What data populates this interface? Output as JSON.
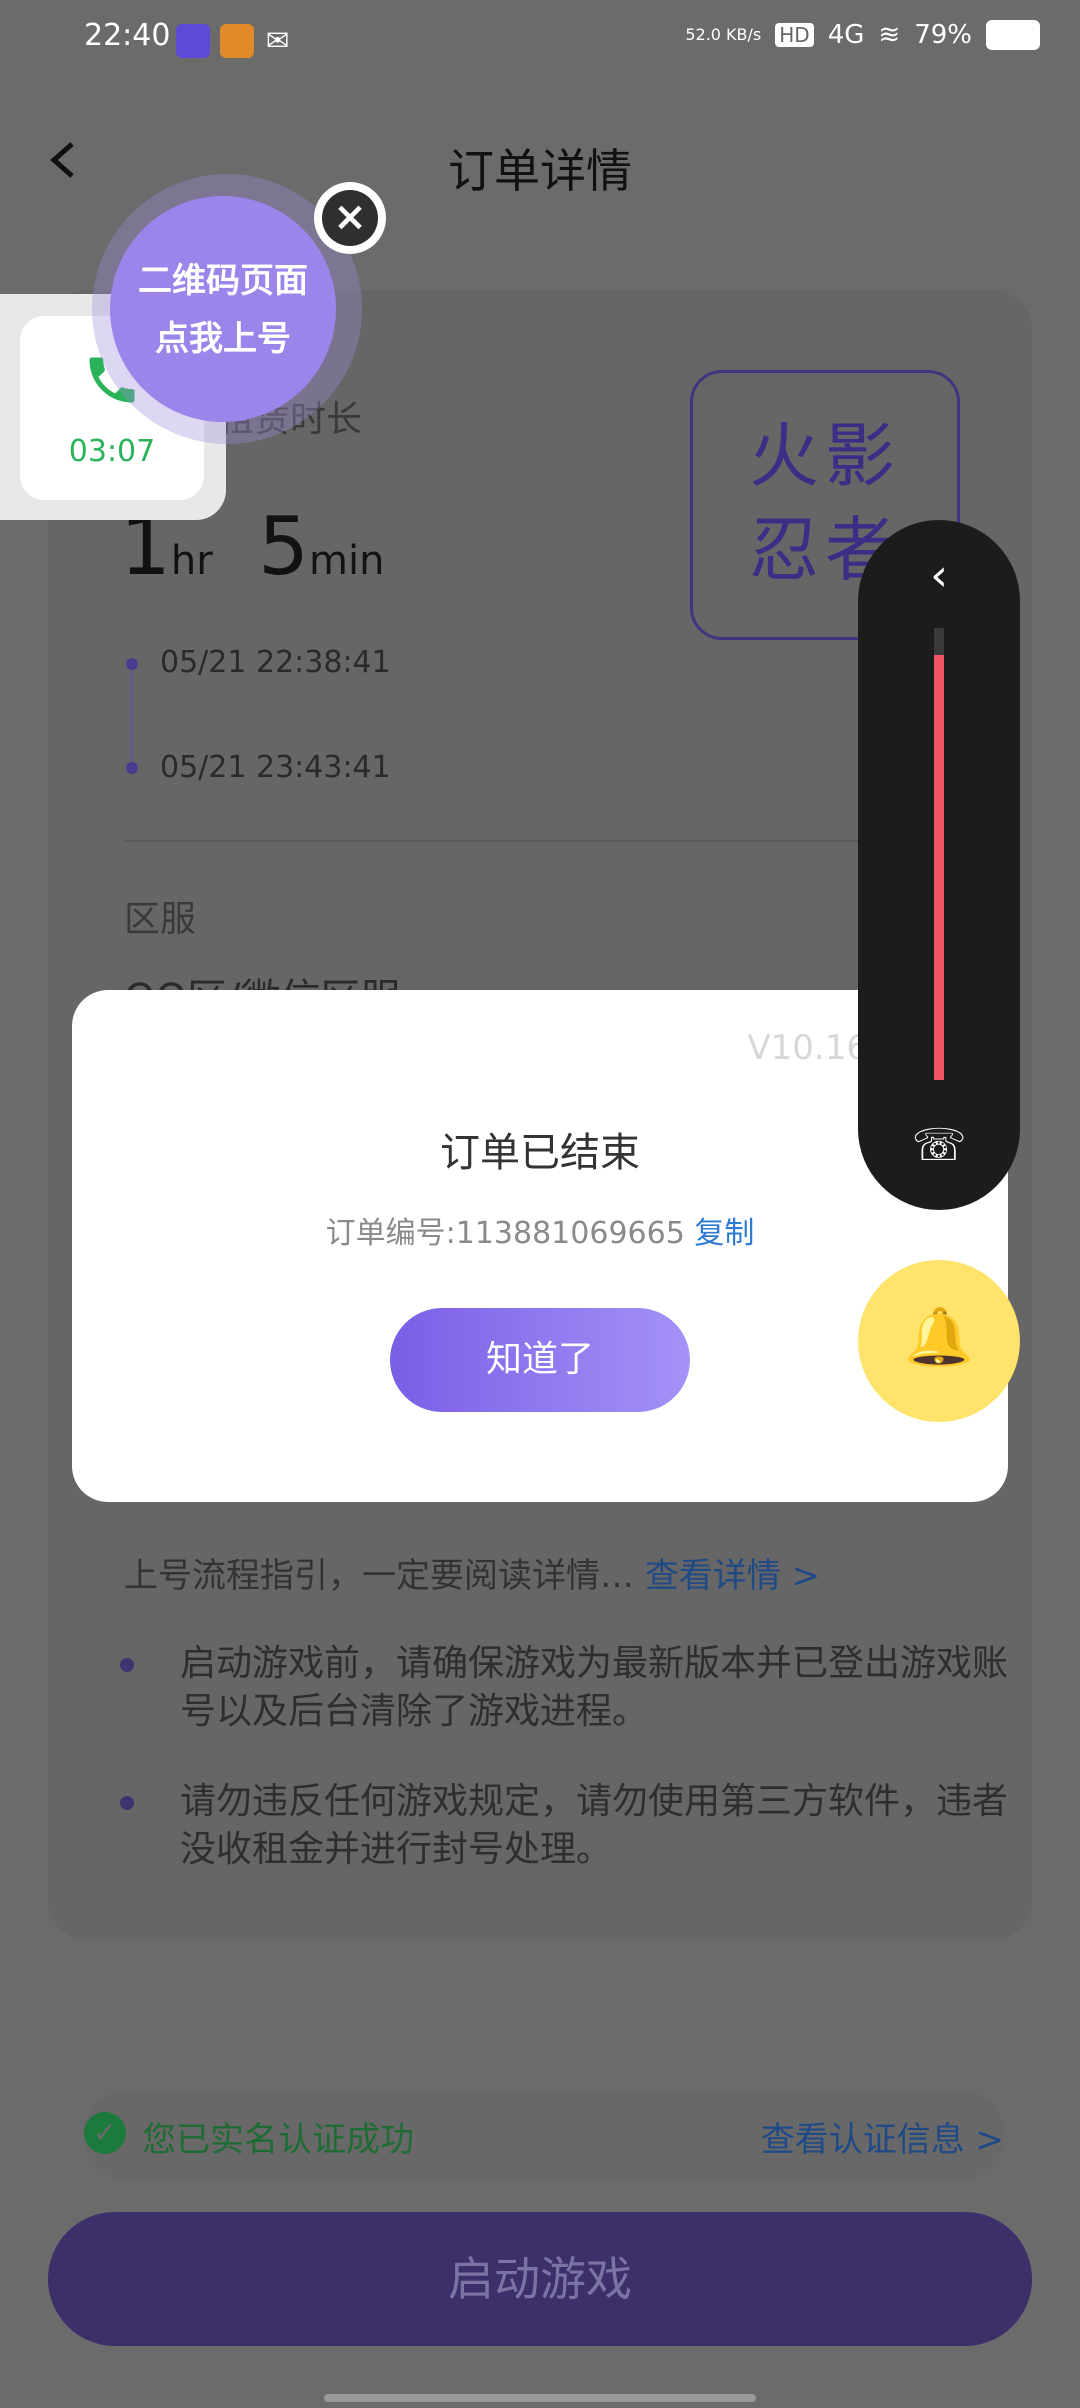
{
  "status": {
    "time": "22:40",
    "net": "52.0 KB/s",
    "hd": "HD",
    "signal": "4G",
    "battery": "79%"
  },
  "header": {
    "title": "订单详情"
  },
  "order": {
    "duration_label": "租赁时长",
    "duration_h": "1",
    "duration_h_unit": "hr",
    "duration_m": "5",
    "duration_m_unit": "min",
    "start": "05/21 22:38:41",
    "end": "05/21 23:43:41",
    "server_label": "区服",
    "server_value": "QQ区/微信区服",
    "game_stamp_line1": "火影",
    "game_stamp_line2": "忍者"
  },
  "guide": {
    "text": "上号流程指引，一定要阅读详情…",
    "link": "查看详情 >",
    "bullets": [
      "启动游戏前，请确保游戏为最新版本并已登出游戏账号以及后台清除了游戏进程。",
      "请勿违反任何游戏规定，请勿使用第三方软件，违者没收租金并进行封号处理。"
    ]
  },
  "verify": {
    "ok_text": "您已实名认证成功",
    "see_text": "查看认证信息 >"
  },
  "start_button": "启动游戏",
  "dialog": {
    "version": "V10.16",
    "title": "订单已结束",
    "order_no_label": "订单编号:113881069665",
    "copy": "复制",
    "ok": "知道了"
  },
  "call_float": {
    "time": "03:07"
  },
  "qr_float": {
    "line1": "二维码页面",
    "line2": "点我上号"
  },
  "volume": {
    "level": 0.94
  },
  "colors": {
    "accent": "#7a5ee6",
    "call_green": "#2bb35a",
    "alert_red": "#f25466",
    "bell_yellow": "#ffe36b"
  }
}
